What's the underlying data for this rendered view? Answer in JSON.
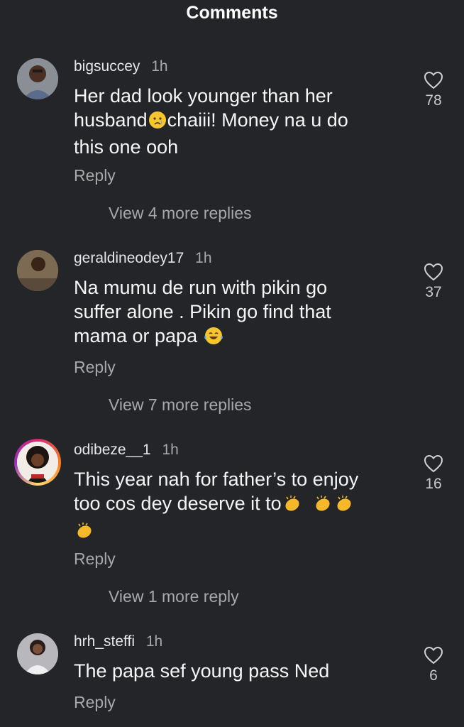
{
  "header": {
    "title": "Comments"
  },
  "comments": [
    {
      "username": "bigsuccey",
      "time": "1h",
      "text_parts": [
        "Her dad look younger than her",
        "husband",
        "chaiii! Money na u do",
        "this one ooh"
      ],
      "emoji": "crying-face",
      "likes": "78",
      "reply_label": "Reply",
      "view_more": "View 4 more replies"
    },
    {
      "username": "geraldineodey17",
      "time": "1h",
      "text_parts": [
        "Na mumu de run with pikin go",
        "suffer alone . Pikin go find that",
        "mama or papa"
      ],
      "emoji": "tears-of-joy",
      "likes": "37",
      "reply_label": "Reply",
      "view_more": "View 7 more replies"
    },
    {
      "username": "odibeze__1",
      "time": "1h",
      "text_parts": [
        "This year nah for father’s to enjoy",
        "too cos dey deserve it to"
      ],
      "emoji": "clapping-hands",
      "likes": "16",
      "reply_label": "Reply",
      "view_more": "View 1 more reply"
    },
    {
      "username": "hrh_steffi",
      "time": "1h",
      "text_parts": [
        "The papa sef young pass Ned"
      ],
      "likes": "6",
      "reply_label": "Reply"
    }
  ],
  "colors": {
    "background": "#242528",
    "muted_text": "#a8a8a8",
    "primary_text": "#f5f5f5"
  }
}
